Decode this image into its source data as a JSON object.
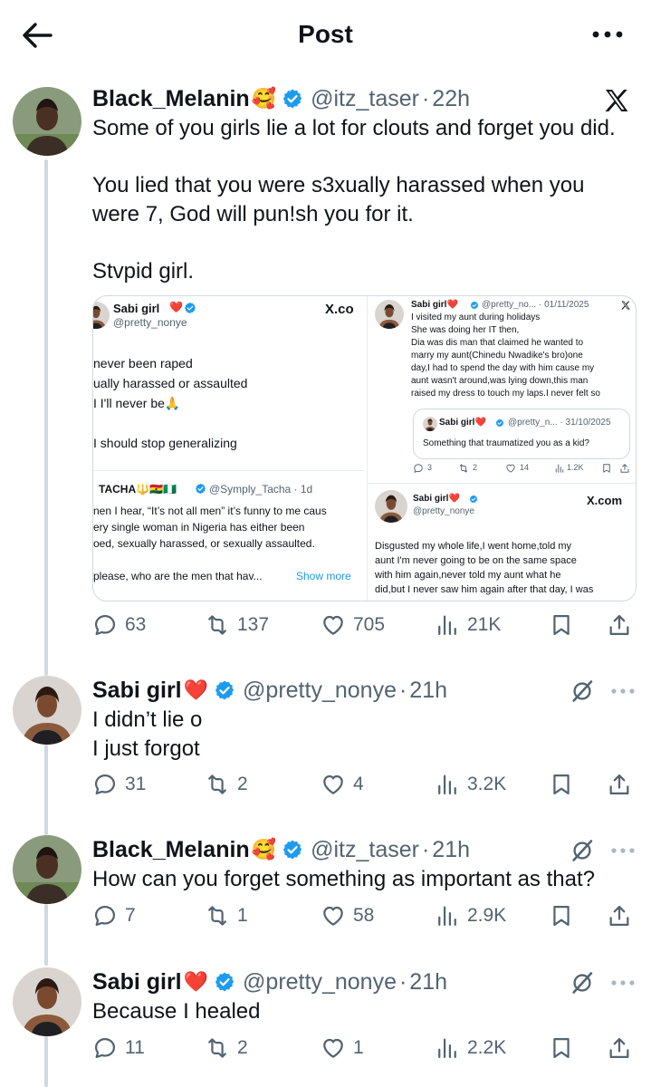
{
  "header": {
    "title": "Post"
  },
  "main_post": {
    "author": {
      "name": "Black_Melanin",
      "emoji": "🥰",
      "handle": "@itz_taser",
      "time": "22h"
    },
    "text": "Some of you girls lie a lot for clouts and forget you did.\n\nYou lied that you were s3xually harassed when you\nwere 7, God will pun!sh you for it.\n\nStvpid girl.",
    "stats": {
      "replies": "63",
      "reposts": "137",
      "likes": "705",
      "views": "21K"
    },
    "embed": {
      "left": {
        "author": "Sabi girl",
        "handle": "@pretty_nonye",
        "brand": "X.co",
        "lines": [
          "never been raped",
          "ually harassed or assaulted",
          "I I'll never be🙏",
          "I should stop generalizing"
        ],
        "quote_author": "TACHA🔱🇬🇭🇳🇬",
        "quote_handle": "@Symply_Tacha · 1d",
        "quote_lines": [
          "nen I hear, “It’s not all men” it’s funny to me caus",
          "ery single woman in Nigeria has either been",
          "oed, sexually harassed, or sexually assaulted."
        ],
        "quote_last": "please, who are the men that hav...",
        "show_more": "Show more"
      },
      "right": {
        "author": "Sabi girl❤️",
        "handle_time": "@pretty_no... · 01/11/2025",
        "lines": [
          "I visited my aunt during holidays",
          "She was doing her IT then,",
          "Dia was dis man that claimed he wanted to",
          "marry my aunt(Chinedu Nwadike's bro)one",
          "day,I had to spend the day with him cause my",
          "aunt wasn't around,was lying down,this man",
          "raised my dress to touch my laps.I never felt so"
        ],
        "quoted": {
          "author": "Sabi girl❤️",
          "handle_time": "@pretty_n... · 31/10/2025",
          "text": "Something that traumatized you as a kid?"
        },
        "stats": {
          "replies": "3",
          "reposts": "2",
          "likes": "14",
          "views": "1.2K"
        },
        "second_author": "Sabi girl❤️",
        "second_handle": "@pretty_nonye",
        "brand": "X.com",
        "second_lines": [
          "Disgusted my whole life,I went home,told my",
          "aunt I'm never going to be on the same space",
          "with him again,never told my aunt what he",
          "did,but I never saw him again after that day, I was"
        ]
      }
    }
  },
  "replies": [
    {
      "name": "Sabi girl",
      "emoji": "❤️",
      "handle": "@pretty_nonye",
      "time": "21h",
      "text": "I didn’t lie o\nI just forgot",
      "stats": {
        "replies": "31",
        "reposts": "2",
        "likes": "4",
        "views": "3.2K"
      }
    },
    {
      "name": "Black_Melanin",
      "emoji": "🥰",
      "handle": "@itz_taser",
      "time": "21h",
      "text": "How can you forget something as important as that?",
      "stats": {
        "replies": "7",
        "reposts": "1",
        "likes": "58",
        "views": "2.9K"
      }
    },
    {
      "name": "Sabi girl",
      "emoji": "❤️",
      "handle": "@pretty_nonye",
      "time": "21h",
      "text": "Because I healed",
      "stats": {
        "replies": "11",
        "reposts": "2",
        "likes": "1",
        "views": "2.2K"
      }
    }
  ],
  "icons": {
    "back": "arrow-left-icon",
    "more": "ellipsis-icon",
    "x_logo": "x-logo-icon",
    "verified": "verified-badge-icon",
    "reply": "reply-icon",
    "repost": "repost-icon",
    "like": "heart-icon",
    "views": "views-icon",
    "bookmark": "bookmark-icon",
    "share": "share-icon",
    "grok": "grok-icon"
  },
  "colors": {
    "verified": "#1d9bf0",
    "secondary_text": "#536471",
    "text": "#0f1419",
    "thread_line": "#cfd9de"
  }
}
